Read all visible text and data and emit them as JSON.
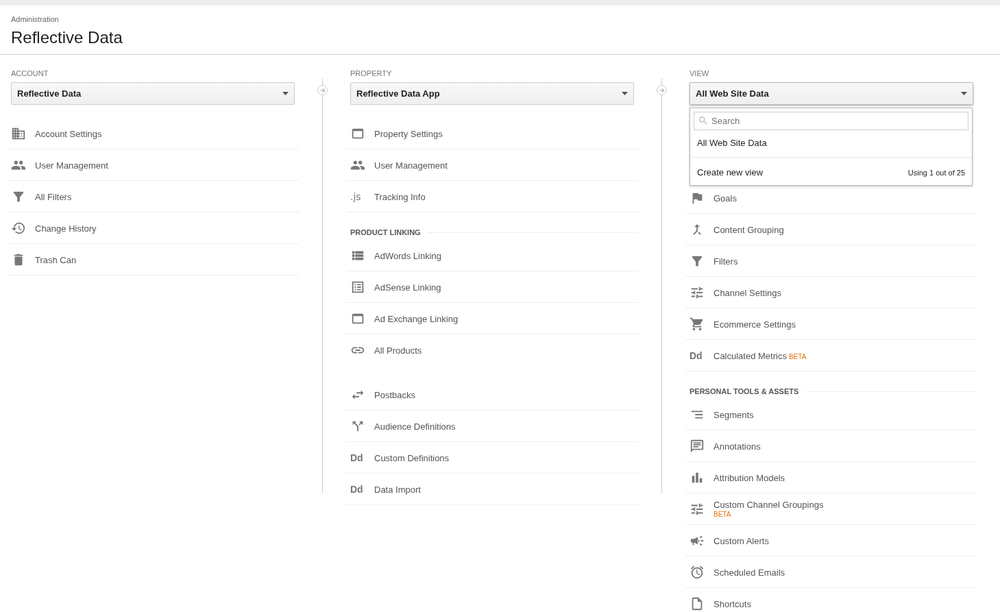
{
  "header": {
    "breadcrumb": "Administration",
    "title": "Reflective Data"
  },
  "columns": [
    {
      "heading": "ACCOUNT",
      "select": {
        "value": "Reflective Data",
        "open": false
      },
      "sections": [
        {
          "items": [
            {
              "label": "Account Settings"
            },
            {
              "label": "User Management"
            },
            {
              "label": "All Filters"
            },
            {
              "label": "Change History"
            },
            {
              "label": "Trash Can"
            }
          ]
        }
      ]
    },
    {
      "heading": "PROPERTY",
      "select": {
        "value": "Reflective Data App",
        "open": false
      },
      "sections": [
        {
          "items": [
            {
              "label": "Property Settings"
            },
            {
              "label": "User Management"
            },
            {
              "label": "Tracking Info",
              "glyph": ".js"
            }
          ]
        },
        {
          "title": "PRODUCT LINKING",
          "items": [
            {
              "label": "AdWords Linking"
            },
            {
              "label": "AdSense Linking"
            },
            {
              "label": "Ad Exchange Linking"
            },
            {
              "label": "All Products"
            }
          ]
        },
        {
          "items": [
            {
              "label": "Postbacks"
            },
            {
              "label": "Audience Definitions"
            },
            {
              "label": "Custom Definitions",
              "glyph": "Dd"
            },
            {
              "label": "Data Import",
              "glyph": "Dd"
            }
          ]
        }
      ]
    },
    {
      "heading": "VIEW",
      "select": {
        "value": "All Web Site Data",
        "open": true
      },
      "menu": {
        "search_placeholder": "Search",
        "options": [
          "All Web Site Data"
        ],
        "create_label": "Create new view",
        "usage": "Using 1 out of 25"
      },
      "sections": [
        {
          "items": [
            {
              "kind": "plain",
              "label": "Goals"
            },
            {
              "kind": "plain",
              "label": "Content Grouping"
            },
            {
              "kind": "plain",
              "label": "Filters"
            },
            {
              "kind": "plain",
              "label": "Channel Settings"
            },
            {
              "kind": "plain",
              "label": "Ecommerce Settings"
            },
            {
              "kind": "inline",
              "label": "Calculated Metrics",
              "glyph": "Dd",
              "badge": "BETA"
            }
          ]
        },
        {
          "title": "PERSONAL TOOLS & ASSETS",
          "items": [
            {
              "kind": "plain",
              "label": "Segments"
            },
            {
              "kind": "plain",
              "label": "Annotations"
            },
            {
              "kind": "plain",
              "label": "Attribution Models"
            },
            {
              "kind": "stacked",
              "label": "Custom Channel Groupings",
              "badge": "BETA"
            },
            {
              "kind": "plain",
              "label": "Custom Alerts"
            },
            {
              "kind": "plain",
              "label": "Scheduled Emails"
            },
            {
              "kind": "plain",
              "label": "Shortcuts"
            }
          ]
        }
      ]
    }
  ]
}
